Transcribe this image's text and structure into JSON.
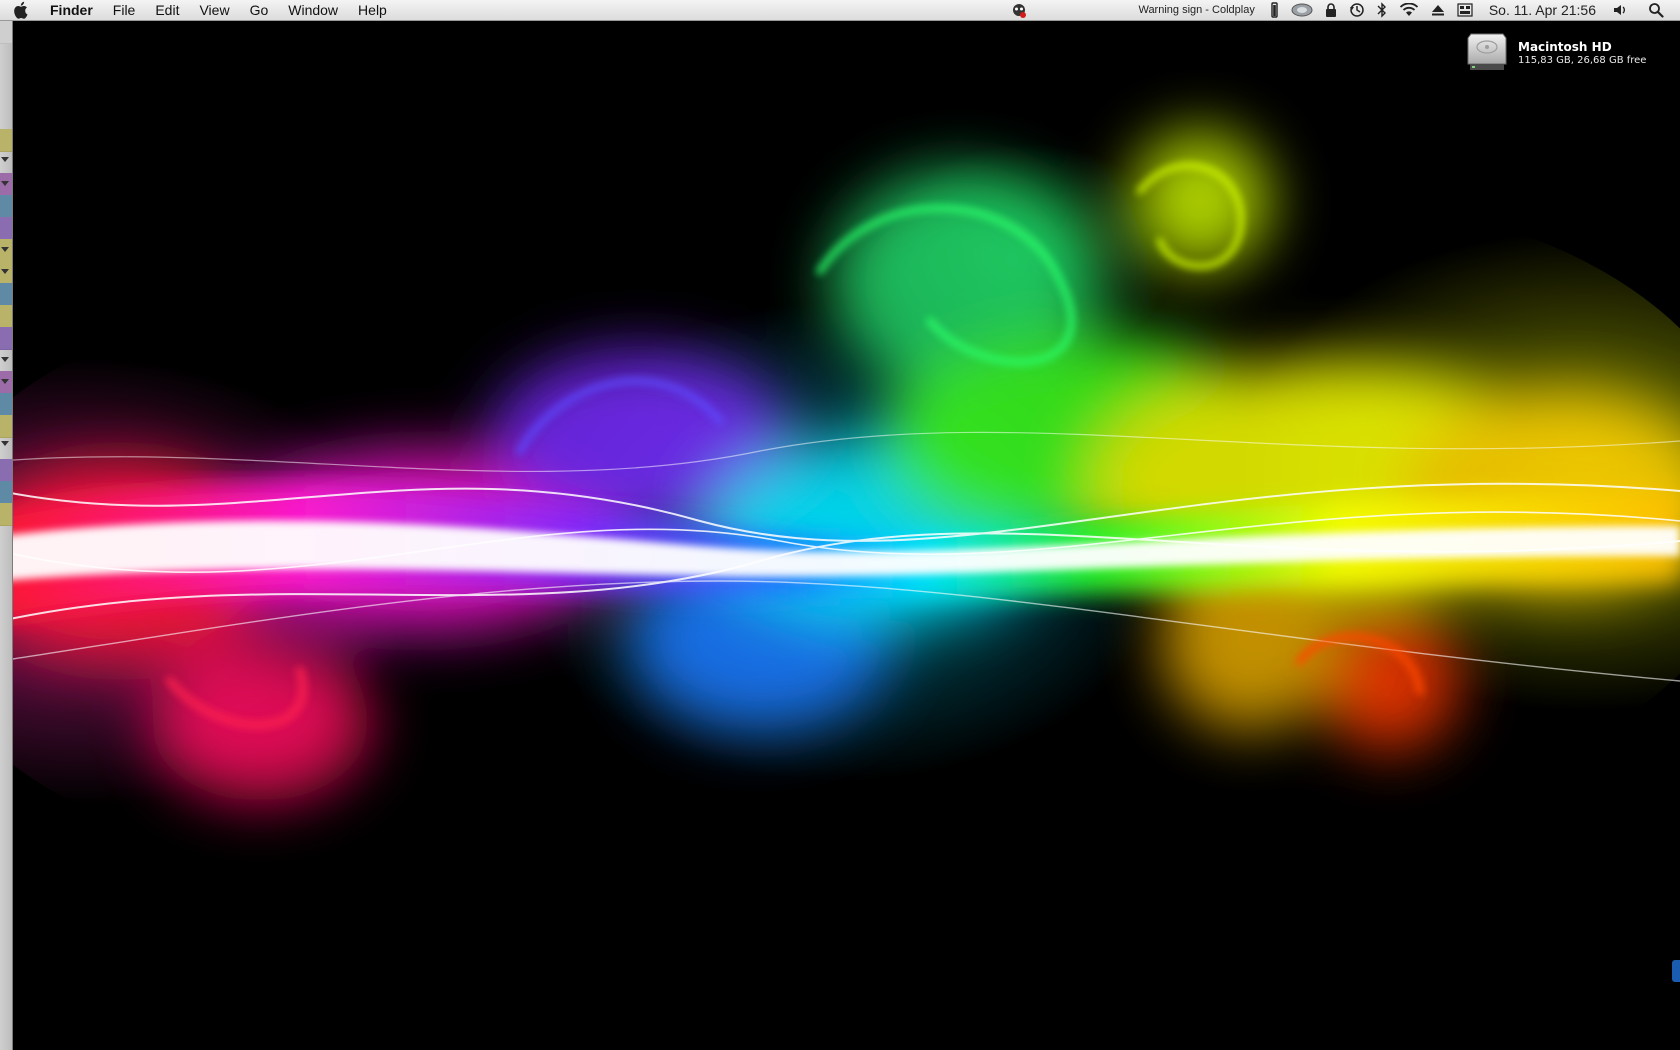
{
  "menubar": {
    "apple_icon": "apple-icon",
    "app_name": "Finder",
    "menus": [
      "File",
      "Edit",
      "View",
      "Go",
      "Window",
      "Help"
    ],
    "now_playing": "Warning sign - Coldplay",
    "clock": "So. 11. Apr  21:56",
    "status_icons": [
      "growl-icon",
      "battery-icon",
      "hard-drive-icon",
      "lock-icon",
      "time-machine-icon",
      "bluetooth-icon",
      "wifi-icon",
      "eject-icon",
      "keyboard-icon",
      "volume-icon",
      "spotlight-icon"
    ]
  },
  "desktop": {
    "drive": {
      "name": "Macintosh HD",
      "info": "115,83 GB, 26,68 GB free"
    },
    "wallpaper": "rainbow-smoke-wallpaper"
  }
}
